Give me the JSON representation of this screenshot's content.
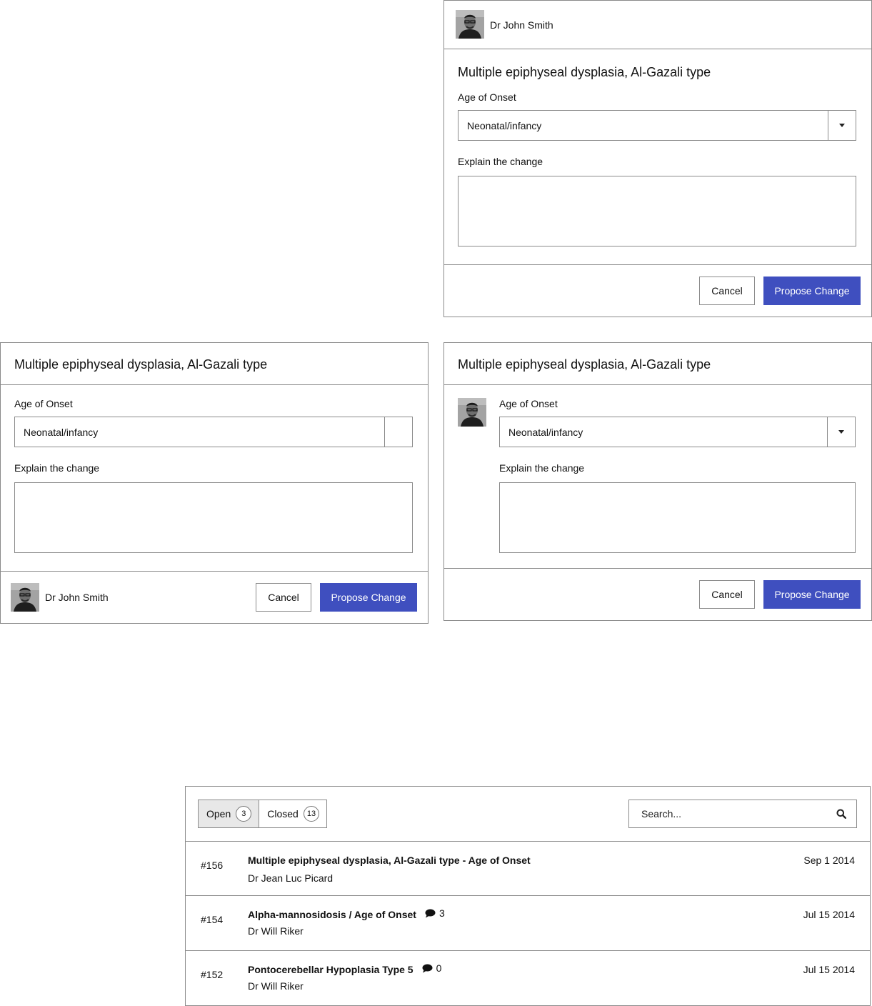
{
  "form": {
    "user_name": "Dr John Smith",
    "title": "Multiple epiphyseal dysplasia, Al-Gazali type",
    "field_label": "Age of Onset",
    "selected_value": "Neonatal/infancy",
    "explain_label": "Explain the change",
    "cancel_label": "Cancel",
    "submit_label": "Propose Change"
  },
  "issues": {
    "tabs": [
      {
        "label": "Open",
        "count": "3"
      },
      {
        "label": "Closed",
        "count": "13"
      }
    ],
    "search_placeholder": "Search...",
    "rows": [
      {
        "number": "#156",
        "title": "Multiple epiphyseal dysplasia, Al-Gazali type - Age of Onset",
        "author": "Dr Jean Luc Picard",
        "date": "Sep 1 2014",
        "comments": null
      },
      {
        "number": "#154",
        "title": "Alpha-mannosidosis / Age of Onset",
        "author": "Dr Will Riker",
        "date": "Jul 15 2014",
        "comments": "3"
      },
      {
        "number": "#152",
        "title": "Pontocerebellar Hypoplasia Type 5",
        "author": "Dr Will Riker",
        "date": "Jul 15 2014",
        "comments": "0"
      }
    ]
  },
  "icons": {
    "avatar": "user-photo",
    "select_caret": "caret-down-icon",
    "search": "magnifier-icon",
    "comment": "speech-bubble-icon"
  },
  "colors": {
    "primary": "#3f4fbf",
    "border": "#8a8a8a",
    "active_tab": "#e8e8e8"
  }
}
